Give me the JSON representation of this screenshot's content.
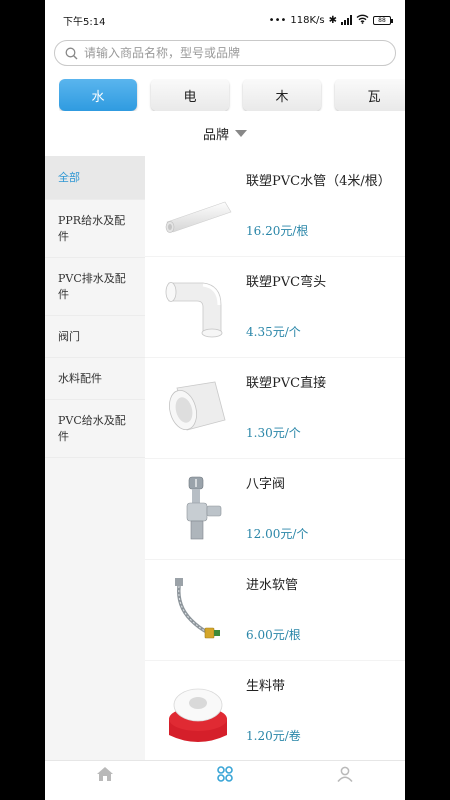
{
  "status_bar": {
    "time": "下午5:14",
    "network_speed": "118K/s",
    "battery": "88"
  },
  "search": {
    "placeholder": "请输入商品名称，型号或品牌"
  },
  "categories": [
    {
      "label": "水",
      "active": true
    },
    {
      "label": "电",
      "active": false
    },
    {
      "label": "木",
      "active": false
    },
    {
      "label": "瓦",
      "active": false
    }
  ],
  "brand_filter": {
    "label": "品牌"
  },
  "sidebar": {
    "items": [
      {
        "label": "全部",
        "active": true
      },
      {
        "label": "PPR给水及配件",
        "active": false
      },
      {
        "label": "PVC排水及配件",
        "active": false
      },
      {
        "label": "阀门",
        "active": false
      },
      {
        "label": "水料配件",
        "active": false
      },
      {
        "label": "PVC给水及配件",
        "active": false
      }
    ]
  },
  "products": [
    {
      "name": "联塑PVC水管（4米/根）",
      "price": "16.20元/根",
      "icon": "pipe-image"
    },
    {
      "name": "联塑PVC弯头",
      "price": "4.35元/个",
      "icon": "elbow-fitting-image"
    },
    {
      "name": "联塑PVC直接",
      "price": "1.30元/个",
      "icon": "coupling-image"
    },
    {
      "name": "八字阀",
      "price": "12.00元/个",
      "icon": "angle-valve-image"
    },
    {
      "name": "进水软管",
      "price": "6.00元/根",
      "icon": "hose-image"
    },
    {
      "name": "生料带",
      "price": "1.20元/卷",
      "icon": "ptfe-tape-image"
    }
  ],
  "tabbar": {
    "items": [
      {
        "icon": "home-icon",
        "active": false
      },
      {
        "icon": "category-icon",
        "active": true
      },
      {
        "icon": "profile-icon",
        "active": false
      }
    ]
  },
  "colors": {
    "accent": "#2f9be0",
    "price": "#2a86a8",
    "sidebar_active_text": "#2f97d3",
    "tab_active": "#3aa5d6",
    "tab_inactive": "#b9b9b9"
  }
}
